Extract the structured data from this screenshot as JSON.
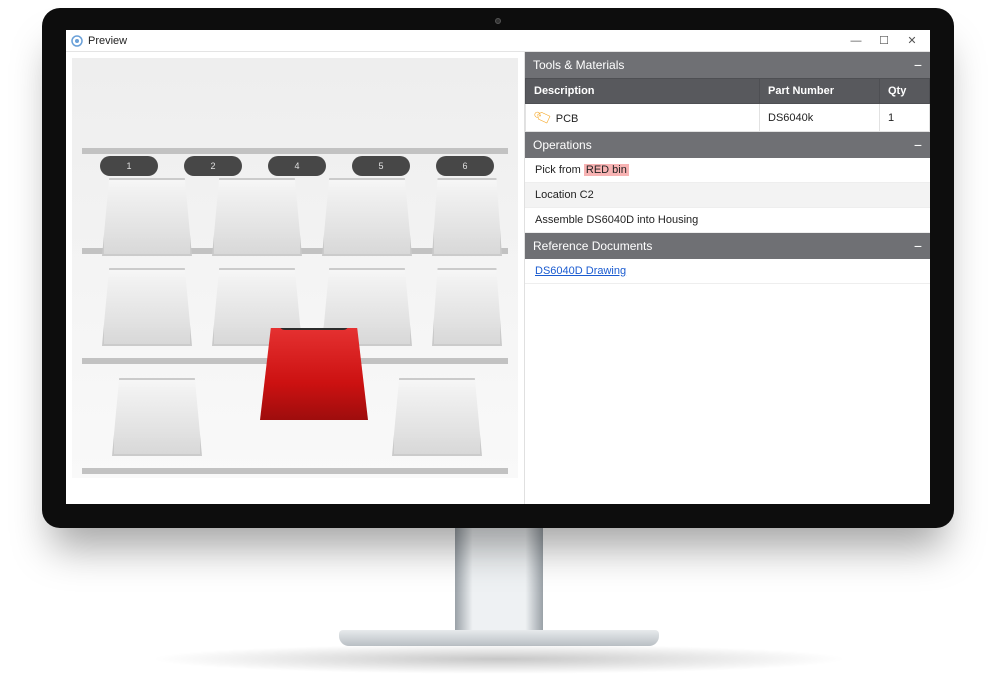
{
  "window": {
    "title": "Preview",
    "minimize": "—",
    "maximize": "☐",
    "close": "✕"
  },
  "bin_labels": [
    "1",
    "2",
    "4",
    "5",
    "6"
  ],
  "sections": {
    "tools": {
      "title": "Tools & Materials",
      "collapse": "−",
      "headers": {
        "description": "Description",
        "part": "Part Number",
        "qty": "Qty"
      },
      "rows": [
        {
          "icon": "tag",
          "description": "PCB",
          "part": "DS6040k",
          "qty": "1"
        }
      ]
    },
    "operations": {
      "title": "Operations",
      "collapse": "−",
      "rows": [
        {
          "prefix": "Pick from ",
          "highlight": "RED bin",
          "suffix": ""
        },
        {
          "text": "Location C2"
        },
        {
          "text": "Assemble DS6040D into Housing"
        }
      ]
    },
    "reference": {
      "title": "Reference Documents",
      "collapse": "−",
      "rows": [
        {
          "link": "DS6040D Drawing"
        }
      ]
    }
  }
}
